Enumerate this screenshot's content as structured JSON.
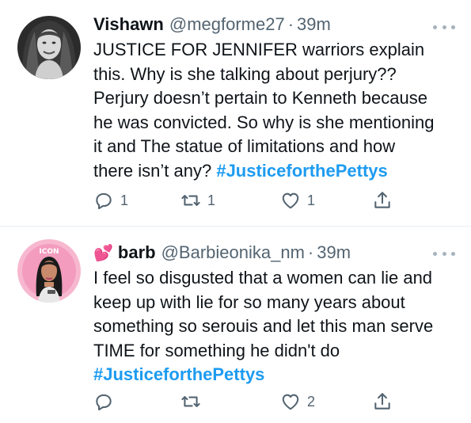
{
  "tweets": [
    {
      "name": "Vishawn",
      "handle": "@megforme27",
      "separator": "·",
      "time": "39m",
      "lines": [
        "JUSTICE FOR JENNIFER warriors explain",
        "this. Why is she talking about perjury??",
        "Perjury doesn’t pertain to Kenneth because",
        "he was convicted. So why is she mentioning",
        "it and The statue of limitations and how",
        "there isn’t any?"
      ],
      "hashtag": "#JusticeforthePettys",
      "replies": "1",
      "retweets": "1",
      "likes": "1",
      "avatar_icon": "profile-photo-braids"
    },
    {
      "emoji": "💕",
      "name": "barb",
      "handle": "@Barbieonika_nm",
      "separator": "·",
      "time": "39m",
      "lines": [
        "I feel so disgusted that a women can lie and",
        "keep up with lie for so many years about",
        "something so serouis and let this man serve",
        "TIME for something he didn't do"
      ],
      "hashtag": "#JusticeforthePettys",
      "replies": "",
      "retweets": "",
      "likes": "2",
      "avatar_icon": "profile-photo-pink",
      "avatar_text": "ICON"
    }
  ],
  "colors": {
    "link": "#1d9bf0",
    "secondary_text": "#536471",
    "divider": "#e6ecf0",
    "primary_text": "#0f1419"
  },
  "icons": [
    "reply-icon",
    "retweet-icon",
    "like-icon",
    "share-icon",
    "more-icon"
  ]
}
